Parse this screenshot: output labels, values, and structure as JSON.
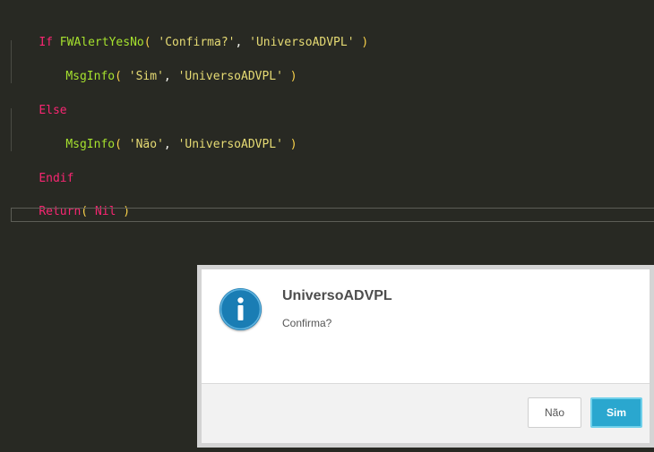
{
  "editor": {
    "lines": {
      "if_kw": "If",
      "if_fn": "FWAlertYesNo",
      "if_open": "(",
      "if_str1": "'Confirma?'",
      "if_comma": ",",
      "if_str2": "'UniversoADVPL'",
      "if_close": ")",
      "msg1_fn": "MsgInfo",
      "msg1_open": "(",
      "msg1_str1": "'Sim'",
      "msg1_comma": ",",
      "msg1_str2": "'UniversoADVPL'",
      "msg1_close": ")",
      "else_kw": "Else",
      "msg2_fn": "MsgInfo",
      "msg2_open": "(",
      "msg2_str1": "'Não'",
      "msg2_comma": ",",
      "msg2_str2": "'UniversoADVPL'",
      "msg2_close": ")",
      "endif_kw": "Endif",
      "return_kw": "Return",
      "return_open": "(",
      "return_val": "Nil",
      "return_close": ")"
    },
    "colors": {
      "background": "#282923",
      "keyword": "#f92672",
      "function": "#a6e22e",
      "string": "#e6db74"
    }
  },
  "dialog": {
    "icon": "info-icon",
    "title": "UniversoADVPL",
    "message": "Confirma?",
    "no_label": "Não",
    "yes_label": "Sim",
    "accent_color": "#2aa7cf"
  }
}
